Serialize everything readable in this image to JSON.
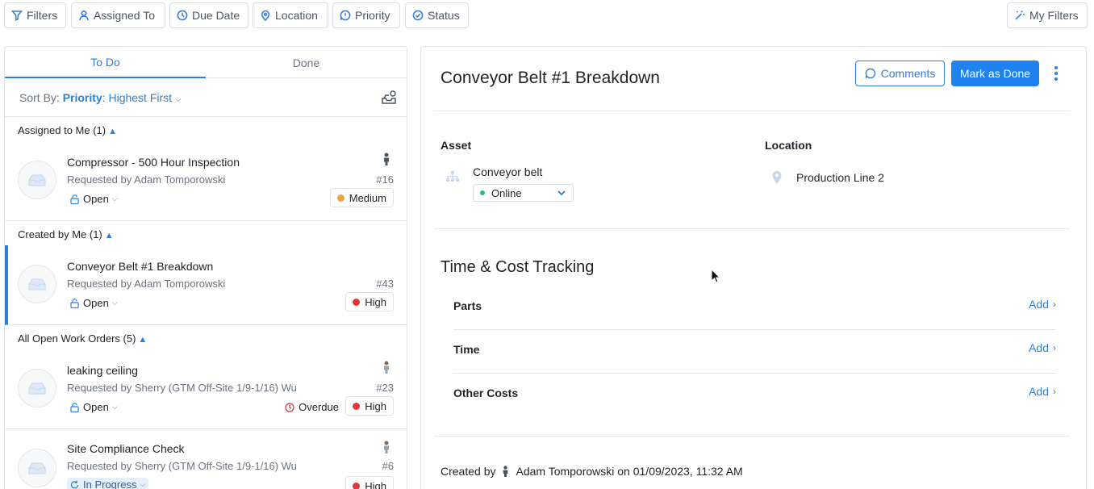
{
  "filters": {
    "filters_label": "Filters",
    "assigned_to_label": "Assigned To",
    "due_date_label": "Due Date",
    "location_label": "Location",
    "priority_label": "Priority",
    "status_label": "Status",
    "my_filters_label": "My Filters"
  },
  "list": {
    "tabs": {
      "todo": "To Do",
      "done": "Done"
    },
    "sort": {
      "prefix": "Sort By:",
      "field": "Priority",
      "value": ": Highest First"
    },
    "groups": {
      "assigned": "Assigned to Me (1)",
      "created": "Created by Me (1)",
      "all_open": "All Open Work Orders (5)"
    },
    "items": [
      {
        "title": "Compressor - 500 Hour Inspection",
        "requested_by": "Requested by Adam Tomporowski",
        "number": "#16",
        "status": "Open",
        "priority": "Medium",
        "priority_color": "#f0a33a"
      },
      {
        "title": "Conveyor Belt #1 Breakdown",
        "requested_by": "Requested by Adam Tomporowski",
        "number": "#43",
        "status": "Open",
        "priority": "High",
        "priority_color": "#e0353b"
      },
      {
        "title": "leaking ceiling",
        "requested_by": "Requested by Sherry (GTM Off-Site 1/9-1/16) Wu",
        "number": "#23",
        "status": "Open",
        "overdue": "Overdue",
        "priority": "High",
        "priority_color": "#e0353b"
      },
      {
        "title": "Site Compliance Check",
        "requested_by": "Requested by Sherry (GTM Off-Site 1/9-1/16) Wu",
        "number": "#6",
        "status": "In Progress",
        "priority": "High",
        "priority_color": "#e0353b"
      }
    ]
  },
  "detail": {
    "title": "Conveyor Belt #1 Breakdown",
    "comments_label": "Comments",
    "mark_done_label": "Mark as Done",
    "asset_label": "Asset",
    "asset_name": "Conveyor belt",
    "asset_status": "Online",
    "asset_status_color": "#2bb58a",
    "location_label": "Location",
    "location_name": "Production Line 2",
    "tracking_title": "Time & Cost Tracking",
    "tracking_rows": [
      {
        "label": "Parts",
        "action": "Add"
      },
      {
        "label": "Time",
        "action": "Add"
      },
      {
        "label": "Other Costs",
        "action": "Add"
      }
    ],
    "created_prefix": "Created by",
    "created_by": "Adam Tomporowski on 01/09/2023, 11:32 AM"
  },
  "colors": {
    "accent": "#2f7fd8",
    "primary_button": "#1f82f1"
  }
}
